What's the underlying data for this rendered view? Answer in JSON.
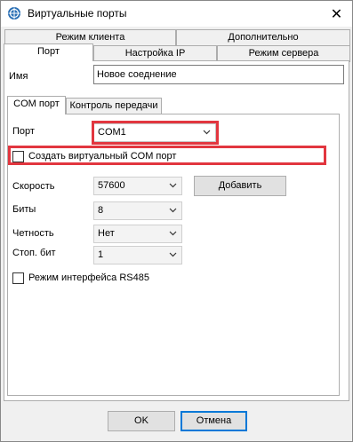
{
  "window": {
    "title": "Виртуальные порты",
    "close_glyph": "✕"
  },
  "tabs_row1": [
    "Режим клиента",
    "Дополнительно"
  ],
  "tabs_row2": [
    "Порт",
    "Настройка IP",
    "Режим сервера"
  ],
  "name_field": {
    "label": "Имя",
    "value": "Новое соеднение"
  },
  "inner_tabs": [
    "COM порт",
    "Контроль передачи"
  ],
  "com": {
    "port_label": "Порт",
    "port_value": "COM1",
    "create_virtual_label": "Создать виртуальный COM порт",
    "create_virtual_checked": false,
    "speed_label": "Скорость",
    "speed_value": "57600",
    "add_button": "Добавить",
    "bits_label": "Биты",
    "bits_value": "8",
    "parity_label": "Четность",
    "parity_value": "Нет",
    "stopbits_label": "Стоп. бит",
    "stopbits_value": "1",
    "rs485_label": "Режим интерфейса RS485",
    "rs485_checked": false
  },
  "buttons": {
    "ok": "OK",
    "cancel": "Отмена"
  },
  "colors": {
    "highlight": "#e2363f",
    "accent": "#0078d7"
  },
  "icons": {
    "app": "app-globe-icon",
    "dropdown": "chevron-down-icon",
    "close": "close-icon"
  }
}
